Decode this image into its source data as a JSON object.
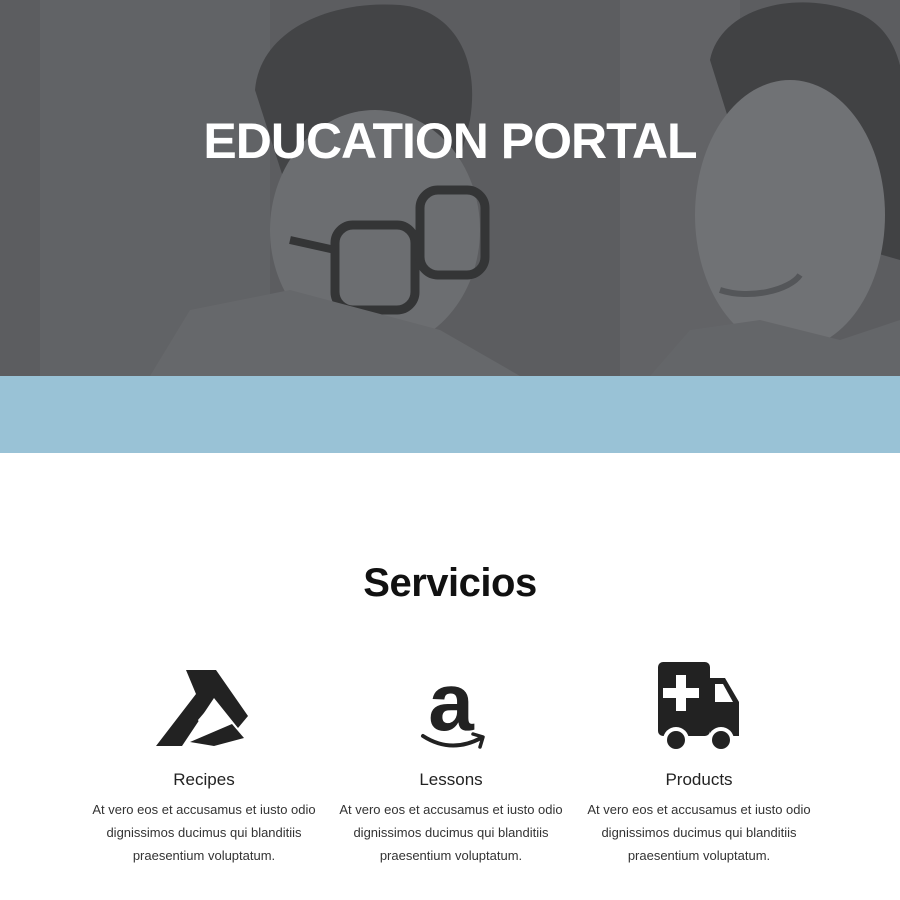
{
  "hero": {
    "title": "EDUCATION PORTAL"
  },
  "services": {
    "title": "Servicios",
    "items": [
      {
        "icon": "abstract-logo-icon",
        "name": "Recipes",
        "text": "At vero eos et accusamus et iusto odio dignissimos ducimus qui blanditiis praesentium voluptatum."
      },
      {
        "icon": "amazon-icon",
        "name": "Lessons",
        "text": "At vero eos et accusamus et iusto odio dignissimos ducimus qui blanditiis praesentium voluptatum."
      },
      {
        "icon": "ambulance-icon",
        "name": "Products",
        "text": "At vero eos et accusamus et iusto odio dignissimos ducimus qui blanditiis praesentium voluptatum."
      }
    ]
  },
  "colors": {
    "band": "#99c2d6",
    "hero_overlay": "#606266",
    "icon": "#222222"
  }
}
